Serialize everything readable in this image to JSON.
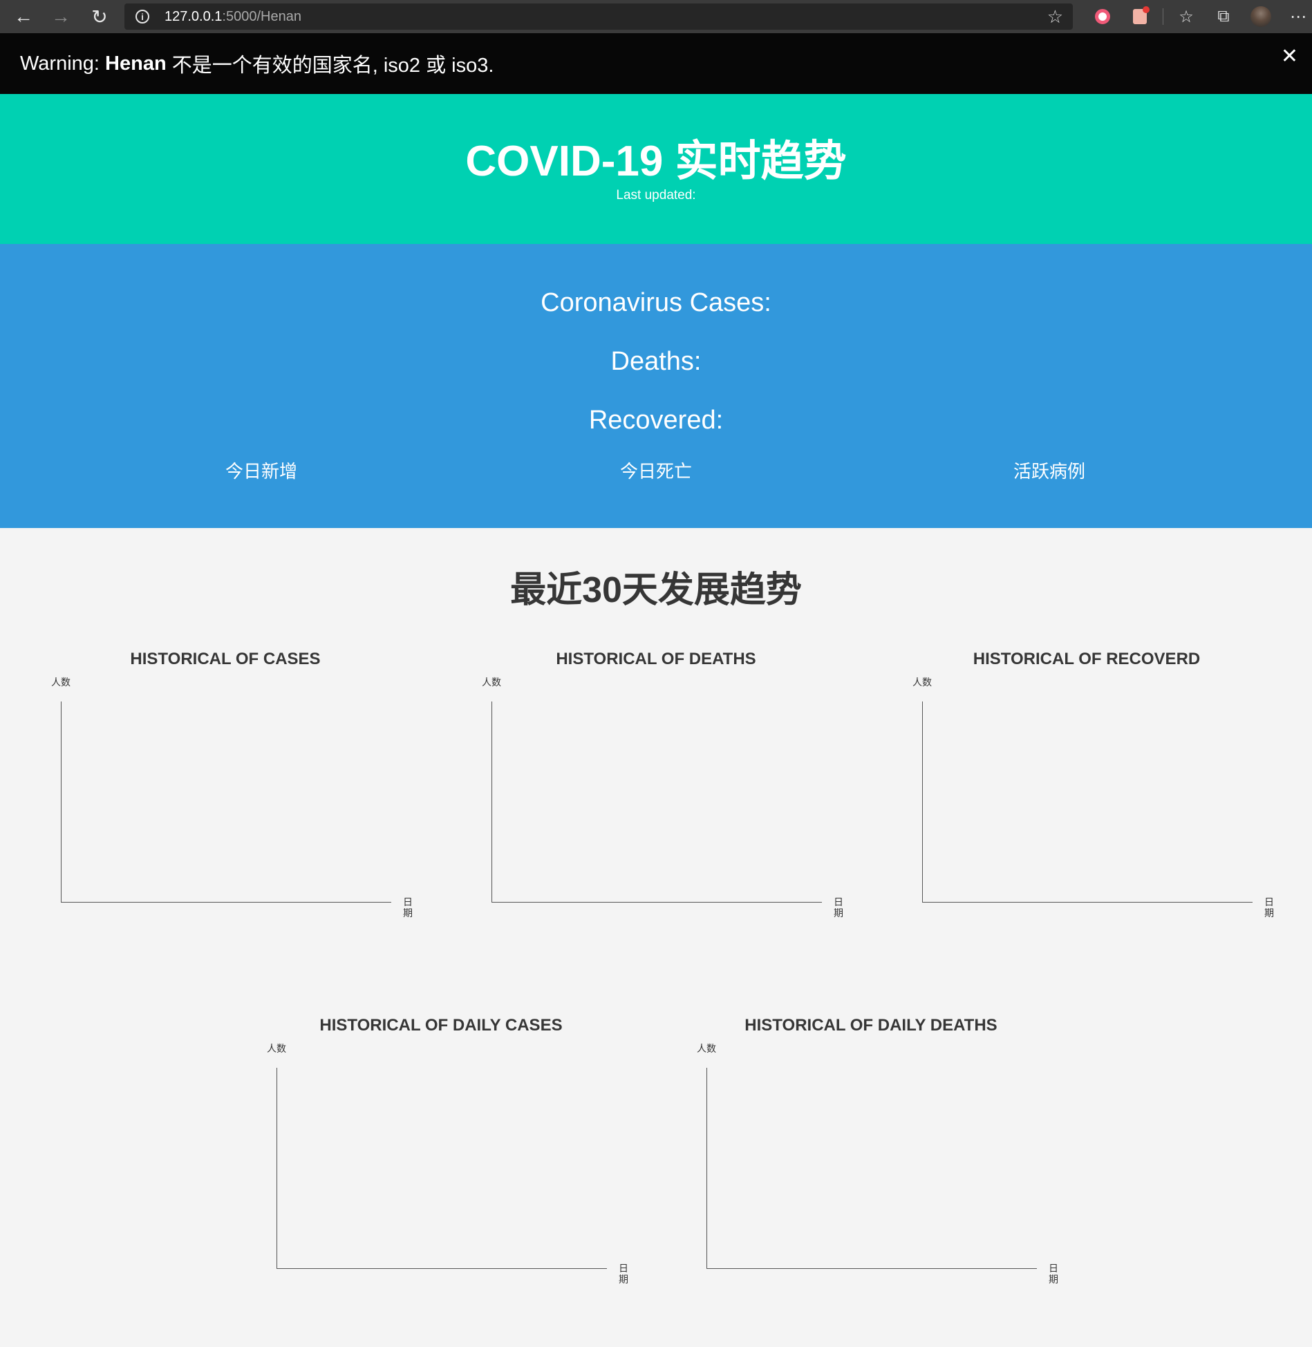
{
  "browser": {
    "url_host": "127.0.0.1",
    "url_path": ":5000/Henan"
  },
  "warning": {
    "prefix": "Warning: ",
    "country": "Henan",
    "message": " 不是一个有效的国家名, iso2 或 iso3.",
    "close_label": "✕"
  },
  "header": {
    "title": "COVID-19 实时趋势",
    "last_updated": "Last updated:"
  },
  "stats": {
    "cases_label": "Coronavirus Cases:",
    "deaths_label": "Deaths:",
    "recovered_label": "Recovered:",
    "today_cases_label": "今日新增",
    "today_deaths_label": "今日死亡",
    "active_label": "活跃病例"
  },
  "trend": {
    "title": "最近30天发展趋势"
  },
  "charts": [
    {
      "title": "HISTORICAL OF CASES",
      "ylabel": "人数",
      "xlabel": "日期"
    },
    {
      "title": "HISTORICAL OF DEATHS",
      "ylabel": "人数",
      "xlabel": "日期"
    },
    {
      "title": "HISTORICAL OF RECOVERD",
      "ylabel": "人数",
      "xlabel": "日期"
    },
    {
      "title": "HISTORICAL OF DAILY CASES",
      "ylabel": "人数",
      "xlabel": "日期"
    },
    {
      "title": "HISTORICAL OF DAILY DEATHS",
      "ylabel": "人数",
      "xlabel": "日期"
    }
  ],
  "chart_data": [
    {
      "type": "line",
      "title": "HISTORICAL OF CASES",
      "xlabel": "日期",
      "ylabel": "人数",
      "x": [],
      "series": []
    },
    {
      "type": "line",
      "title": "HISTORICAL OF DEATHS",
      "xlabel": "日期",
      "ylabel": "人数",
      "x": [],
      "series": []
    },
    {
      "type": "line",
      "title": "HISTORICAL OF RECOVERD",
      "xlabel": "日期",
      "ylabel": "人数",
      "x": [],
      "series": []
    },
    {
      "type": "line",
      "title": "HISTORICAL OF DAILY CASES",
      "xlabel": "日期",
      "ylabel": "人数",
      "x": [],
      "series": []
    },
    {
      "type": "line",
      "title": "HISTORICAL OF DAILY DEATHS",
      "xlabel": "日期",
      "ylabel": "人数",
      "x": [],
      "series": []
    }
  ]
}
